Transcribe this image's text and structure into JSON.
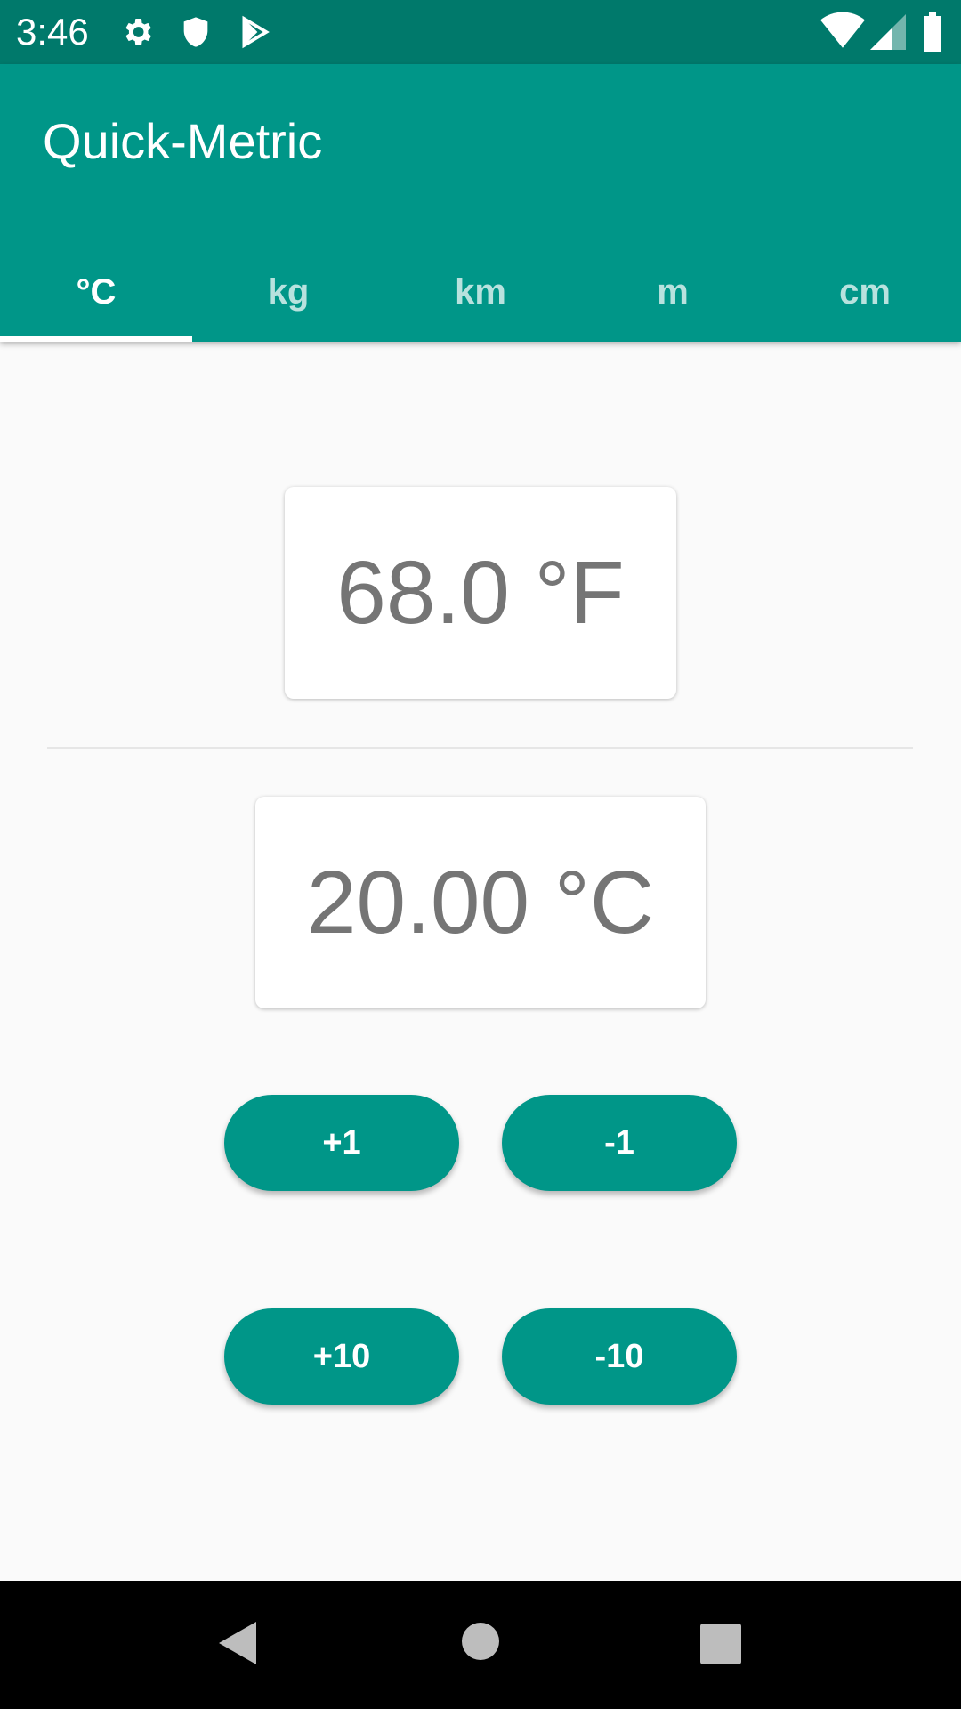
{
  "status_bar": {
    "time": "3:46",
    "icons": [
      "settings-icon",
      "shield-icon",
      "play-store-icon",
      "wifi-icon",
      "signal-icon",
      "battery-icon"
    ]
  },
  "app": {
    "title": "Quick-Metric",
    "accent_color": "#009688",
    "status_color": "#00796b"
  },
  "tabs": [
    {
      "label": "°C",
      "selected": true
    },
    {
      "label": "kg",
      "selected": false
    },
    {
      "label": "km",
      "selected": false
    },
    {
      "label": "m",
      "selected": false
    },
    {
      "label": "cm",
      "selected": false
    }
  ],
  "converter": {
    "fahrenheit_value": "68.0 °F",
    "celsius_value": "20.00 °C"
  },
  "buttons": {
    "plus_one": "+1",
    "minus_one": "-1",
    "plus_ten": "+10",
    "minus_ten": "-10"
  },
  "nav_bar": {
    "icons": [
      "back-icon",
      "home-icon",
      "recents-icon"
    ]
  }
}
